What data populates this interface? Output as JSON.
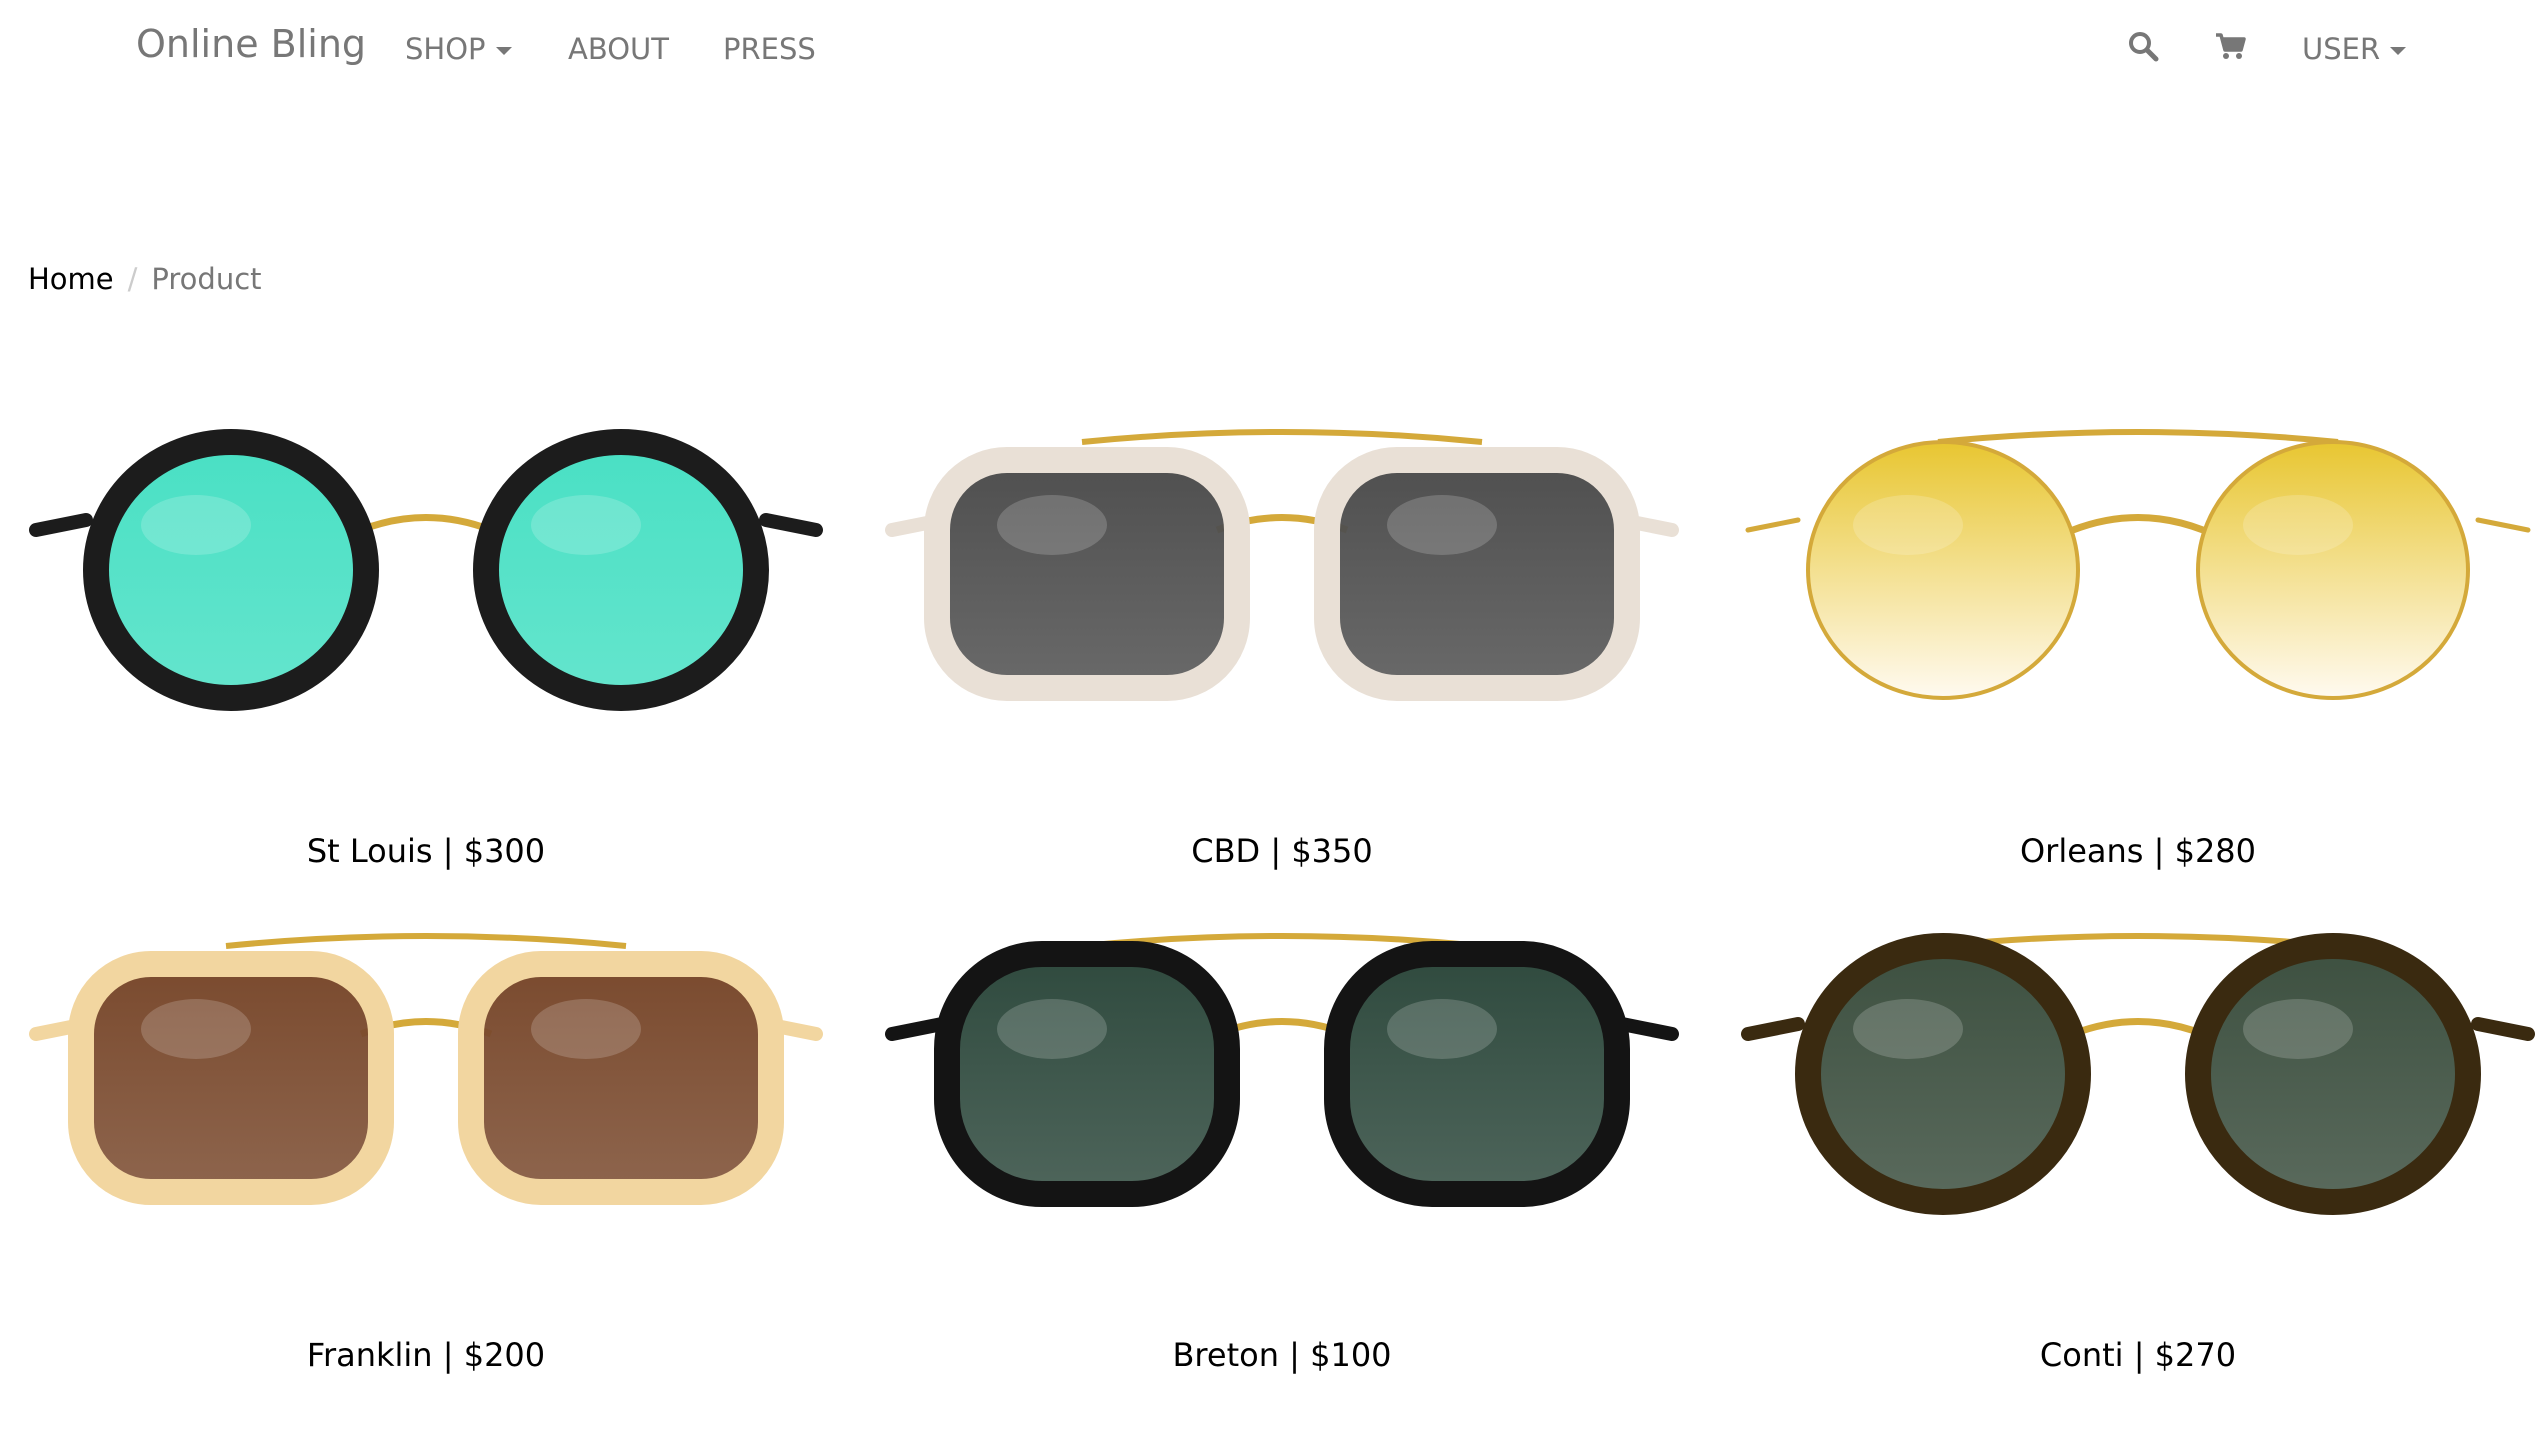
{
  "nav": {
    "brand": "Online Bling",
    "shop": "SHOP",
    "about": "ABOUT",
    "press": "PRESS",
    "user": "USER",
    "search_icon": "search-icon",
    "cart_icon": "cart-icon"
  },
  "breadcrumb": {
    "home": "Home",
    "separator": "/",
    "current": "Product"
  },
  "products": [
    {
      "name": "St Louis",
      "price": "$300",
      "label": "St Louis | $300",
      "frame": "#1c1c1c",
      "lens": "#49e0c4",
      "accent": "#d4a93a",
      "style": "round"
    },
    {
      "name": "CBD",
      "price": "$350",
      "label": "CBD | $350",
      "frame": "#e9e0d6",
      "lens": "#4f4f4f",
      "accent": "#d4a93a",
      "style": "square"
    },
    {
      "name": "Orleans",
      "price": "$280",
      "label": "Orleans | $280",
      "frame": "#d6a33c",
      "lens": "#e8c631",
      "accent": "#d4a93a",
      "style": "wire"
    },
    {
      "name": "Franklin",
      "price": "$200",
      "label": "Franklin | $200",
      "frame": "#f2d6a0",
      "lens": "#7a4a2e",
      "accent": "#d4a93a",
      "style": "square"
    },
    {
      "name": "Breton",
      "price": "$100",
      "label": "Breton | $100",
      "frame": "#141414",
      "lens": "#2f4a3e",
      "accent": "#d4a93a",
      "style": "aviator"
    },
    {
      "name": "Conti",
      "price": "$270",
      "label": "Conti | $270",
      "frame": "#3a2a10",
      "lens": "#3d5040",
      "accent": "#d4a93a",
      "style": "round"
    }
  ]
}
